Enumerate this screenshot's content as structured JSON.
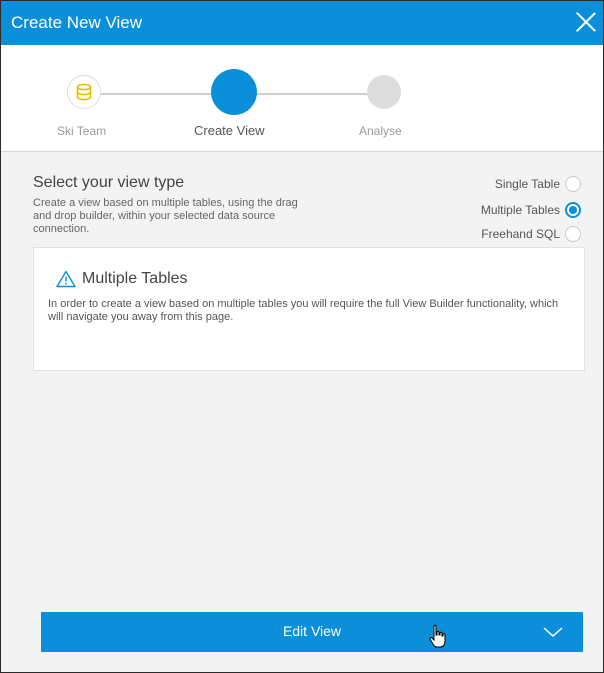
{
  "dialog": {
    "title": "Create New View"
  },
  "stepper": {
    "steps": [
      {
        "label": "Ski Team",
        "state": "done",
        "icon": "database-icon"
      },
      {
        "label": "Create View",
        "state": "active"
      },
      {
        "label": "Analyse",
        "state": "pending"
      }
    ]
  },
  "view_type": {
    "heading": "Select your view type",
    "description": "Create a view based on multiple tables, using the drag and drop builder, within your selected data source connection.",
    "options": [
      {
        "label": "Single Table",
        "selected": false
      },
      {
        "label": "Multiple Tables",
        "selected": true
      },
      {
        "label": "Freehand SQL",
        "selected": false
      }
    ]
  },
  "info_panel": {
    "icon": "warning-icon",
    "title": "Multiple Tables",
    "text": "In order to create a view based on multiple tables you will require the full View Builder functionality, which will navigate you away from this page."
  },
  "footer": {
    "edit_label": "Edit View",
    "icon": "chevron-down-icon"
  },
  "colors": {
    "accent": "#0b8fd8",
    "step_icon": "#e6c200"
  }
}
